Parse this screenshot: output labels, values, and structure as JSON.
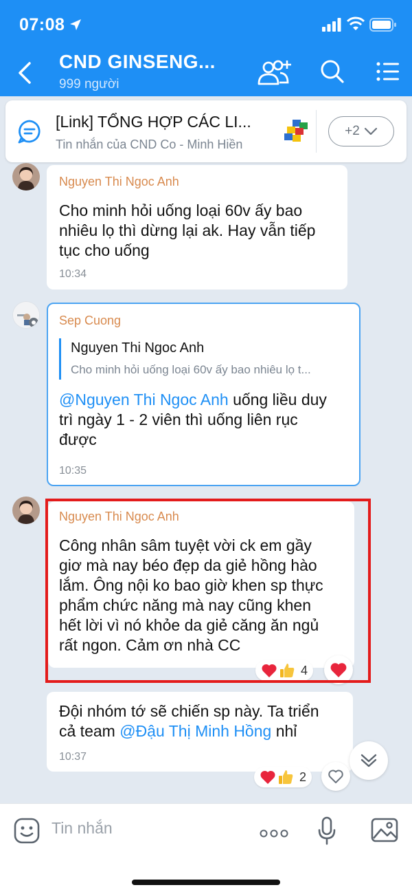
{
  "status_bar": {
    "time": "07:08"
  },
  "header": {
    "title": "CND GINSENG...",
    "members": "999 người"
  },
  "pinned": {
    "title": "[Link] TỔNG HỢP CÁC LI...",
    "subtitle": "Tin nhắn của CND Co - Minh Hiền",
    "more_label": "+2"
  },
  "messages": [
    {
      "sender": "Nguyen Thi Ngoc Anh",
      "lines": [
        "Cho minh hỏi uống  loại 60v ấy bao",
        "nhiêu lọ thì dừng lại ak. Hay vẫn tiếp",
        "tục cho uống"
      ],
      "time": "10:34"
    },
    {
      "sender": "Sep Cuong",
      "quote": {
        "name": "Nguyen Thi Ngoc Anh",
        "text": "Cho minh hỏi uống  loại 60v ấy bao nhiêu lọ t..."
      },
      "mention": "@Nguyen Thi Ngoc Anh",
      "line1_rest": " uống liều duy",
      "lines": [
        "trì ngày 1 - 2 viên thì uống liên rục",
        "được"
      ],
      "time": "10:35"
    },
    {
      "sender": "Nguyen Thi Ngoc Anh",
      "lines": [
        "Công nhân sâm tuyệt vời ck em gầy",
        "giơ mà nay béo đẹp da giẻ hồng hào",
        "lắm. Ông nội ko bao giờ khen sp thực",
        "phẩm chức năng mà nay cũng khen",
        "hết lời vì nó khỏe da giẻ căng ăn ngủ",
        "rất ngon. Cảm ơn nhà CC"
      ],
      "reaction_count": "4"
    },
    {
      "line1": "Đội nhóm tớ sẽ chiến sp này. Ta triển",
      "line2_start": "cả team ",
      "mention": "@Đậu Thị Minh Hồng",
      "line2_end": " nhỉ",
      "time": "10:37",
      "reaction_count": "2"
    }
  ],
  "input": {
    "placeholder": "Tin nhắn"
  },
  "colors": {
    "header": "#1e8ff5",
    "sender": "#d88a4e",
    "mention": "#1e8ff5",
    "highlight": "#e31b1b",
    "background": "#e2e9f1"
  },
  "icons": [
    "location-arrow-icon",
    "signal-icon",
    "wifi-icon",
    "battery-icon",
    "back-arrow-icon",
    "add-member-icon",
    "search-icon",
    "list-menu-icon",
    "chat-bubble-icon",
    "chevron-down-icon",
    "heart-icon",
    "thumbs-up-icon",
    "emoji-icon",
    "more-dots-icon",
    "mic-icon",
    "image-icon"
  ]
}
